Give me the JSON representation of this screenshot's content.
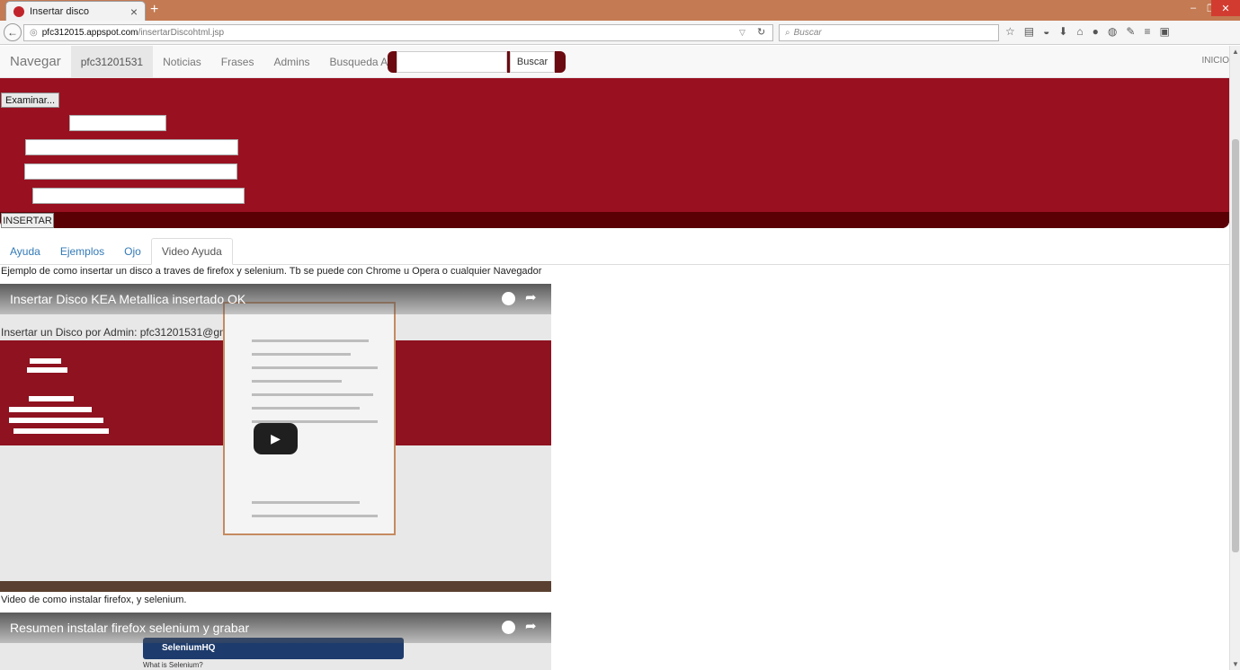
{
  "browser": {
    "tab_title": "Insertar disco",
    "url_host": "pfc312015.appspot.com",
    "url_path": "/insertarDiscohtml.jsp",
    "search_placeholder": "Buscar"
  },
  "nav": {
    "brand": "Navegar",
    "items": [
      "pfc31201531",
      "Noticias",
      "Frases",
      "Admins",
      "Busqueda Avanzada"
    ],
    "search_button": "Buscar",
    "right_link": "INICIO"
  },
  "form": {
    "file_button": "Examinar...",
    "submit_button": "INSERTAR"
  },
  "tabs": [
    "Ayuda",
    "Ejemplos",
    "Ojo",
    "Video Ayuda"
  ],
  "content": {
    "description_1": "Ejemplo de como insertar un disco a traves de firefox y selenium. Tb se puede con Chrome u Opera o cualquier Navegador",
    "description_2": "Video de como instalar firefox, y selenium."
  },
  "videos": [
    {
      "title": "Insertar Disco KEA Metallica insertado OK",
      "subtitle": "Insertar un Disco por Admin: pfc31201531@gma"
    },
    {
      "title": "Resumen instalar firefox selenium y grabar",
      "banner": "SeleniumHQ",
      "caption": "What is Selenium?"
    }
  ],
  "colors": {
    "titlebar": "#c47a52",
    "form_panel": "#991020",
    "form_footer": "#5a0005",
    "link": "#337ab7"
  }
}
